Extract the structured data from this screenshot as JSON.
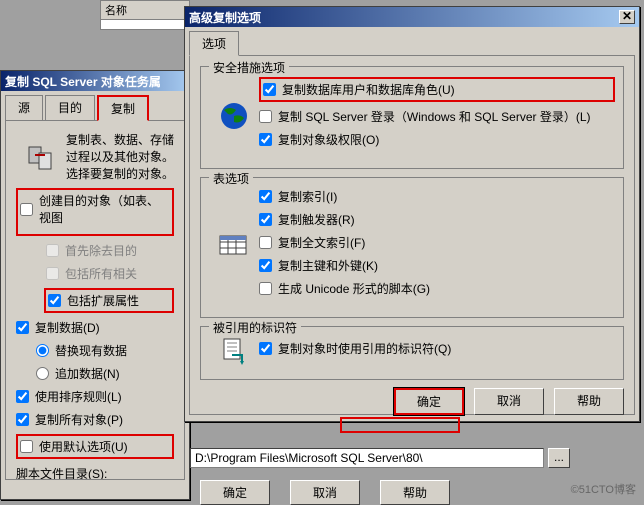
{
  "topbar": {
    "col1": "名称"
  },
  "backWin": {
    "title": "复制 SQL Server 对象任务属",
    "tabs": {
      "source": "源",
      "dest": "目的",
      "copy": "复制"
    },
    "desc": "复制表、数据、存储过程以及其他对象。选择要复制的对象。",
    "cb_createDest": "创建目的对象（如表、视图",
    "cb_dropFirst": "首先除去目的",
    "cb_includeDeps": "包括所有相关",
    "cb_includeExt": "包括扩展属性",
    "cb_copyData": "复制数据(D)",
    "rb_replace": "替换现有数据",
    "rb_append": "追加数据(N)",
    "cb_useSort": "使用排序规则(L)",
    "cb_copyAll": "复制所有对象(P)",
    "cb_useDefault": "使用默认选项(U)",
    "lbl_scriptDir": "脚本文件目录(S):",
    "scriptPath": "D:\\Program Files\\Microsoft SQL Server\\80\\",
    "btns": {
      "ok": "确定",
      "cancel": "取消",
      "help": "帮助"
    }
  },
  "frontWin": {
    "title": "高级复制选项",
    "tab": "选项",
    "grp_security": "安全措施选项",
    "cb_copyDbUsers": "复制数据库用户和数据库角色(U)",
    "cb_copyLogins": "复制 SQL Server 登录（Windows 和 SQL Server 登录）(L)",
    "cb_copyObjPerms": "复制对象级权限(O)",
    "grp_table": "表选项",
    "cb_copyIndexes": "复制索引(I)",
    "cb_copyTriggers": "复制触发器(R)",
    "cb_copyFulltext": "复制全文索引(F)",
    "cb_copyPkFk": "复制主键和外键(K)",
    "cb_genUnicode": "生成 Unicode 形式的脚本(G)",
    "grp_quoted": "被引用的标识符",
    "cb_useQuoted": "复制对象时使用引用的标识符(Q)",
    "btns": {
      "ok": "确定",
      "cancel": "取消",
      "help": "帮助"
    }
  },
  "watermark": "©51CTO博客"
}
